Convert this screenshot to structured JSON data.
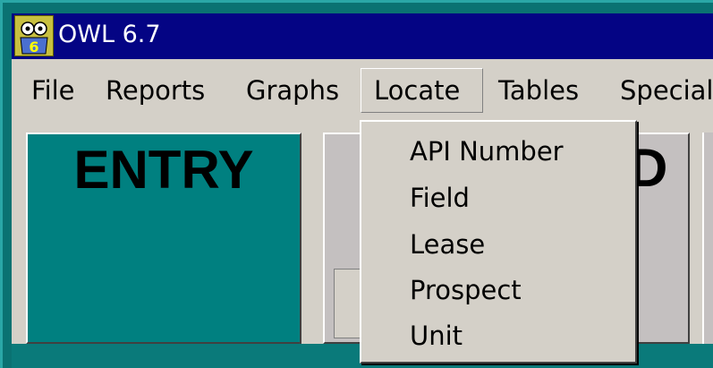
{
  "window": {
    "title": "OWL 6.7",
    "icon": "owl-app-icon"
  },
  "menubar": {
    "items": [
      {
        "label": "File"
      },
      {
        "label": "Reports"
      },
      {
        "label": "Graphs"
      },
      {
        "label": "Locate"
      },
      {
        "label": "Tables"
      },
      {
        "label": "Special"
      }
    ]
  },
  "panels": {
    "entry_label": "ENTRY",
    "second_visible_char": "D"
  },
  "locate_menu": {
    "items": [
      {
        "label": "API Number"
      },
      {
        "label": "Field"
      },
      {
        "label": "Lease"
      },
      {
        "label": "Prospect"
      },
      {
        "label": "Unit"
      }
    ]
  },
  "colors": {
    "desktop": "#008080",
    "titlebar": "#040484",
    "menu_face": "#d4d0c8",
    "entry_panel": "#008080"
  }
}
